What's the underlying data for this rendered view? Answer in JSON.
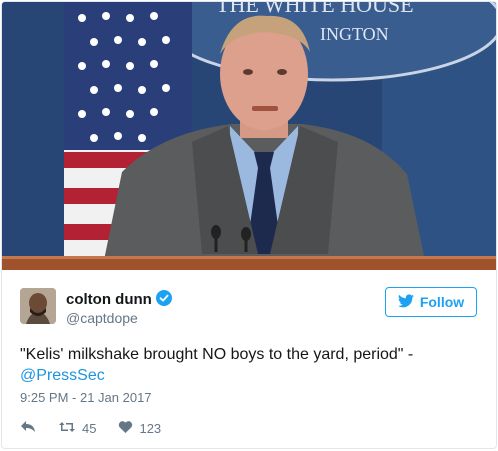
{
  "tweet": {
    "display_name": "colton dunn",
    "handle": "@captdope",
    "follow_label": "Follow",
    "text": "\"Kelis' milkshake brought NO boys to the yard, period\" -",
    "mention": "@PressSec",
    "timestamp": "9:25 PM - 21 Jan 2017",
    "retweets": "45",
    "likes": "123"
  },
  "media": {
    "backdrop_text_top": "THE WHITE HOUSE",
    "backdrop_text_bottom": "INGTON"
  },
  "icons": {
    "verified": "verified-badge-icon",
    "bird": "twitter-bird-icon",
    "reply": "reply-icon",
    "retweet": "retweet-icon",
    "like": "heart-icon"
  },
  "colors": {
    "accent": "#1da1f2",
    "mention": "#1b95e0",
    "text": "#14171a",
    "muted": "#657786",
    "backdrop": "#2b4a78",
    "podium": "#a0522d"
  }
}
